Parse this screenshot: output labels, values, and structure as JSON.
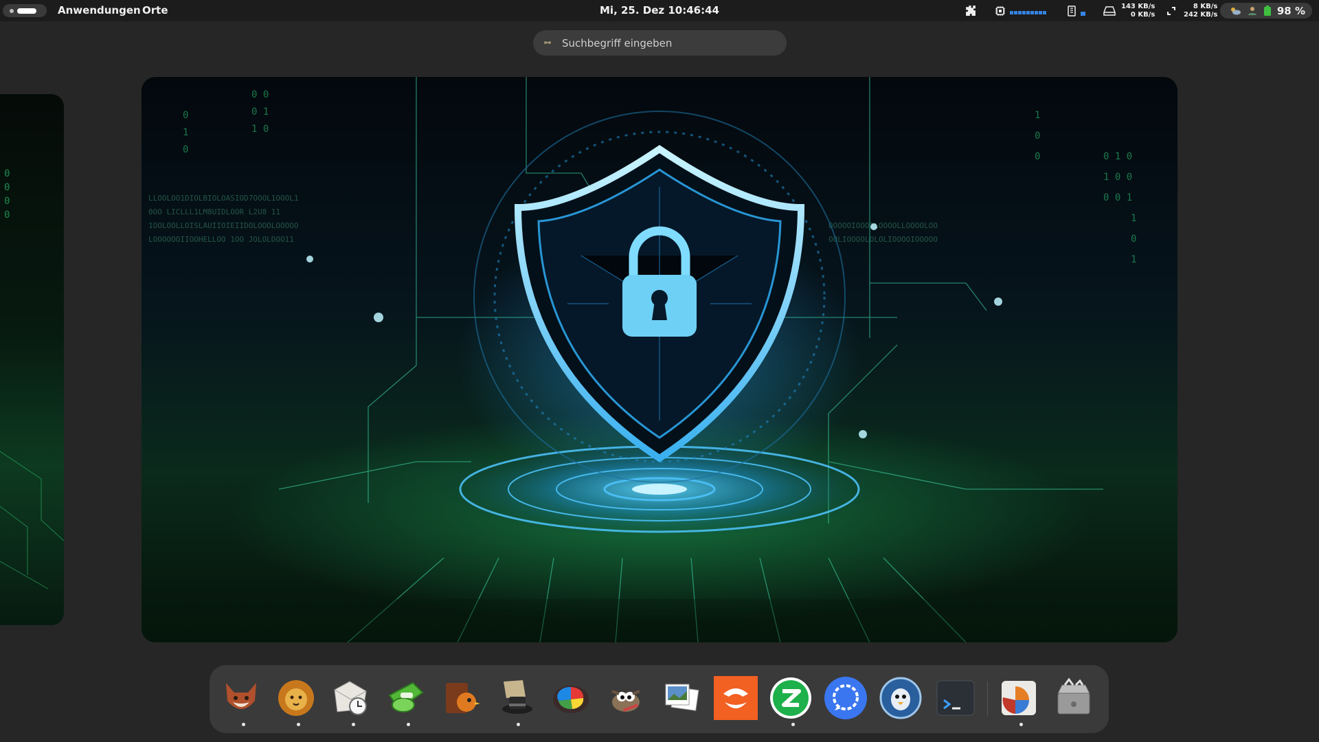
{
  "topbar": {
    "menu": {
      "applications": "Anwendungen",
      "places": "Orte"
    },
    "clock": "Mi, 25. Dez  10:46:44",
    "net1": {
      "up": "143 KB/s",
      "down": "0 KB/s"
    },
    "net2": {
      "up": "8 KB/s",
      "down": "242 KB/s"
    },
    "battery": "98 %",
    "icons": [
      "extension-icon",
      "cpu-icon",
      "memory-icon",
      "drive-icon",
      "network-icon",
      "weather-icon",
      "user-icon",
      "battery-icon"
    ]
  },
  "search": {
    "placeholder": "Suchbegriff eingeben"
  },
  "workspace": {
    "wallpaper": "cybersecurity-shield-lock",
    "accent": "#36a6e8",
    "glow": "#2fd07a"
  },
  "dock": {
    "apps": [
      {
        "name": "fox-app",
        "running": true
      },
      {
        "name": "lion-app",
        "running": true
      },
      {
        "name": "mail-clock-app",
        "running": true
      },
      {
        "name": "green-utility-app",
        "running": true
      },
      {
        "name": "book-bird-app",
        "running": false
      },
      {
        "name": "hat-app",
        "running": true
      },
      {
        "name": "color-wheel-app",
        "running": false
      },
      {
        "name": "gimp-app",
        "running": false
      },
      {
        "name": "photo-viewer-app",
        "running": false
      },
      {
        "name": "orange-app",
        "running": false
      },
      {
        "name": "green-chat-app",
        "running": true
      },
      {
        "name": "signal-app",
        "running": false
      },
      {
        "name": "penguin-chat-app",
        "running": false
      },
      {
        "name": "terminal-app",
        "running": false
      },
      {
        "name": "disk-usage-app",
        "running": true
      },
      {
        "name": "trash-app",
        "running": false
      }
    ]
  }
}
